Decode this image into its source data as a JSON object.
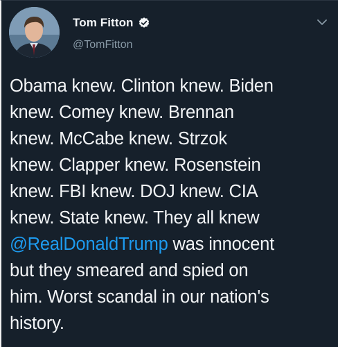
{
  "tweet": {
    "display_name": "Tom Fitton",
    "handle": "@TomFitton",
    "lines": [
      "Obama knew. Clinton knew. Biden",
      "knew. Comey knew. Brennan",
      "knew. McCabe knew. Strzok",
      "knew. Clapper knew. Rosenstein",
      "knew. FBI knew. DOJ knew. CIA",
      "knew. State knew. They all knew"
    ],
    "mention": "@RealDonaldTrump",
    "mention_suffix": " was innocent",
    "lines_after": [
      "but they smeared and spied on",
      "him. Worst scandal in our nation's",
      "history."
    ]
  },
  "icons": {
    "verified": "verified-badge-icon",
    "menu": "chevron-down-icon"
  },
  "colors": {
    "background": "#16202b",
    "text": "#f2f4f6",
    "handle": "#8899a6",
    "mention": "#1d9bf0"
  }
}
